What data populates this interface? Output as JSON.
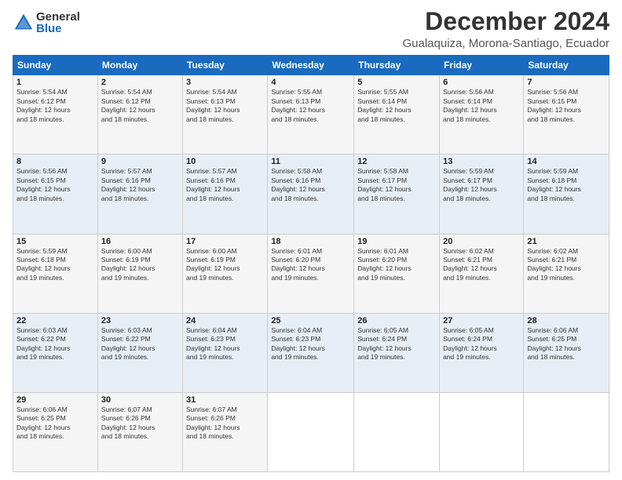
{
  "logo": {
    "general": "General",
    "blue": "Blue"
  },
  "title": "December 2024",
  "subtitle": "Gualaquiza, Morona-Santiago, Ecuador",
  "headers": [
    "Sunday",
    "Monday",
    "Tuesday",
    "Wednesday",
    "Thursday",
    "Friday",
    "Saturday"
  ],
  "weeks": [
    [
      {
        "day": "1",
        "sunrise": "5:54 AM",
        "sunset": "6:12 PM",
        "daylight": "12 hours and 18 minutes."
      },
      {
        "day": "2",
        "sunrise": "5:54 AM",
        "sunset": "6:12 PM",
        "daylight": "12 hours and 18 minutes."
      },
      {
        "day": "3",
        "sunrise": "5:54 AM",
        "sunset": "6:13 PM",
        "daylight": "12 hours and 18 minutes."
      },
      {
        "day": "4",
        "sunrise": "5:55 AM",
        "sunset": "6:13 PM",
        "daylight": "12 hours and 18 minutes."
      },
      {
        "day": "5",
        "sunrise": "5:55 AM",
        "sunset": "6:14 PM",
        "daylight": "12 hours and 18 minutes."
      },
      {
        "day": "6",
        "sunrise": "5:56 AM",
        "sunset": "6:14 PM",
        "daylight": "12 hours and 18 minutes."
      },
      {
        "day": "7",
        "sunrise": "5:56 AM",
        "sunset": "6:15 PM",
        "daylight": "12 hours and 18 minutes."
      }
    ],
    [
      {
        "day": "8",
        "sunrise": "5:56 AM",
        "sunset": "6:15 PM",
        "daylight": "12 hours and 18 minutes."
      },
      {
        "day": "9",
        "sunrise": "5:57 AM",
        "sunset": "6:16 PM",
        "daylight": "12 hours and 18 minutes."
      },
      {
        "day": "10",
        "sunrise": "5:57 AM",
        "sunset": "6:16 PM",
        "daylight": "12 hours and 18 minutes."
      },
      {
        "day": "11",
        "sunrise": "5:58 AM",
        "sunset": "6:16 PM",
        "daylight": "12 hours and 18 minutes."
      },
      {
        "day": "12",
        "sunrise": "5:58 AM",
        "sunset": "6:17 PM",
        "daylight": "12 hours and 18 minutes."
      },
      {
        "day": "13",
        "sunrise": "5:59 AM",
        "sunset": "6:17 PM",
        "daylight": "12 hours and 18 minutes."
      },
      {
        "day": "14",
        "sunrise": "5:59 AM",
        "sunset": "6:18 PM",
        "daylight": "12 hours and 18 minutes."
      }
    ],
    [
      {
        "day": "15",
        "sunrise": "5:59 AM",
        "sunset": "6:18 PM",
        "daylight": "12 hours and 19 minutes."
      },
      {
        "day": "16",
        "sunrise": "6:00 AM",
        "sunset": "6:19 PM",
        "daylight": "12 hours and 19 minutes."
      },
      {
        "day": "17",
        "sunrise": "6:00 AM",
        "sunset": "6:19 PM",
        "daylight": "12 hours and 19 minutes."
      },
      {
        "day": "18",
        "sunrise": "6:01 AM",
        "sunset": "6:20 PM",
        "daylight": "12 hours and 19 minutes."
      },
      {
        "day": "19",
        "sunrise": "6:01 AM",
        "sunset": "6:20 PM",
        "daylight": "12 hours and 19 minutes."
      },
      {
        "day": "20",
        "sunrise": "6:02 AM",
        "sunset": "6:21 PM",
        "daylight": "12 hours and 19 minutes."
      },
      {
        "day": "21",
        "sunrise": "6:02 AM",
        "sunset": "6:21 PM",
        "daylight": "12 hours and 19 minutes."
      }
    ],
    [
      {
        "day": "22",
        "sunrise": "6:03 AM",
        "sunset": "6:22 PM",
        "daylight": "12 hours and 19 minutes."
      },
      {
        "day": "23",
        "sunrise": "6:03 AM",
        "sunset": "6:22 PM",
        "daylight": "12 hours and 19 minutes."
      },
      {
        "day": "24",
        "sunrise": "6:04 AM",
        "sunset": "6:23 PM",
        "daylight": "12 hours and 19 minutes."
      },
      {
        "day": "25",
        "sunrise": "6:04 AM",
        "sunset": "6:23 PM",
        "daylight": "12 hours and 19 minutes."
      },
      {
        "day": "26",
        "sunrise": "6:05 AM",
        "sunset": "6:24 PM",
        "daylight": "12 hours and 19 minutes."
      },
      {
        "day": "27",
        "sunrise": "6:05 AM",
        "sunset": "6:24 PM",
        "daylight": "12 hours and 19 minutes."
      },
      {
        "day": "28",
        "sunrise": "6:06 AM",
        "sunset": "6:25 PM",
        "daylight": "12 hours and 18 minutes."
      }
    ],
    [
      {
        "day": "29",
        "sunrise": "6:06 AM",
        "sunset": "6:25 PM",
        "daylight": "12 hours and 18 minutes."
      },
      {
        "day": "30",
        "sunrise": "6:07 AM",
        "sunset": "6:26 PM",
        "daylight": "12 hours and 18 minutes."
      },
      {
        "day": "31",
        "sunrise": "6:07 AM",
        "sunset": "6:26 PM",
        "daylight": "12 hours and 18 minutes."
      },
      null,
      null,
      null,
      null
    ]
  ]
}
